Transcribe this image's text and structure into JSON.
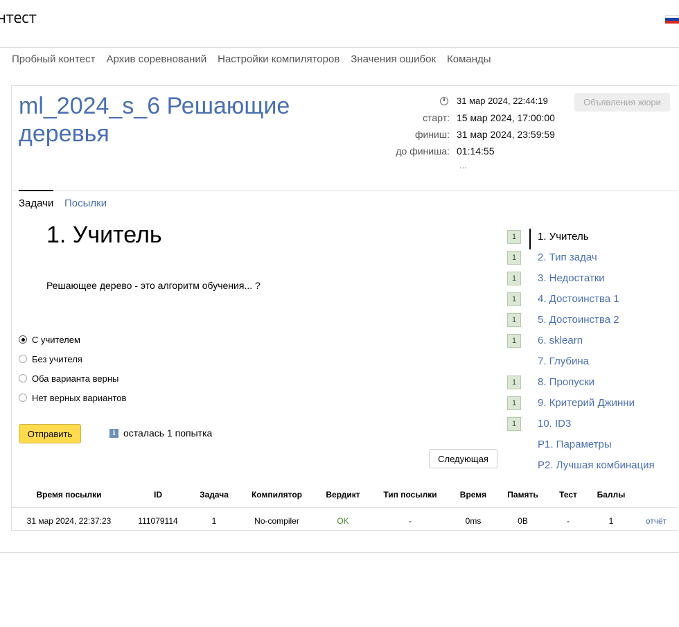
{
  "header": {
    "logo_text": "нтест"
  },
  "nav": [
    "Пробный контест",
    "Архив соревнований",
    "Настройки компиляторов",
    "Значения ошибок",
    "Команды"
  ],
  "contest": {
    "title": "ml_2024_s_6 Решающие деревья",
    "now": "31 мар 2024, 22:44:19",
    "start_label": "старт:",
    "start": "15 мар 2024, 17:00:00",
    "finish_label": "финиш:",
    "finish": "31 мар 2024, 23:59:59",
    "remaining_label": "до финиша:",
    "remaining": "01:14:55",
    "more": "...",
    "jury_button": "Объявления жюри"
  },
  "tabs": {
    "tasks": "Задачи",
    "submissions": "Посылки"
  },
  "task": {
    "title": "1. Учитель",
    "statement": "Решающее дерево - это алгоритм обучения... ?",
    "options": [
      "С учителем",
      "Без учителя",
      "Оба варианта верны",
      "Нет верных вариантов"
    ],
    "selected_index": 0,
    "submit_label": "Отправить",
    "attempts_text": "осталась 1 попытка",
    "next_label": "Следующая"
  },
  "problems": [
    {
      "badge": "1",
      "label": "1. Учитель"
    },
    {
      "badge": "1",
      "label": "2. Тип задач"
    },
    {
      "badge": "1",
      "label": "3. Недостатки"
    },
    {
      "badge": "1",
      "label": "4. Достоинства 1"
    },
    {
      "badge": "1",
      "label": "5. Достоинства 2"
    },
    {
      "badge": "1",
      "label": "6. sklearn"
    },
    {
      "badge": "",
      "label": "7. Глубина"
    },
    {
      "badge": "1",
      "label": "8. Пропуски"
    },
    {
      "badge": "1",
      "label": "9. Критерий Джинни"
    },
    {
      "badge": "1",
      "label": "10. ID3"
    },
    {
      "badge": "",
      "label": "P1. Параметры"
    },
    {
      "badge": "",
      "label": "P2. Лучшая комбинация"
    }
  ],
  "submissions": {
    "headers": [
      "Время посылки",
      "ID",
      "Задача",
      "Компилятор",
      "Вердикт",
      "Тип посылки",
      "Время",
      "Память",
      "Тест",
      "Баллы",
      ""
    ],
    "rows": [
      [
        "31 мар 2024, 22:37:23",
        "111079114",
        "1",
        "No-compiler",
        "OK",
        "-",
        "0ms",
        "0B",
        "-",
        "1",
        "отчёт"
      ]
    ]
  }
}
